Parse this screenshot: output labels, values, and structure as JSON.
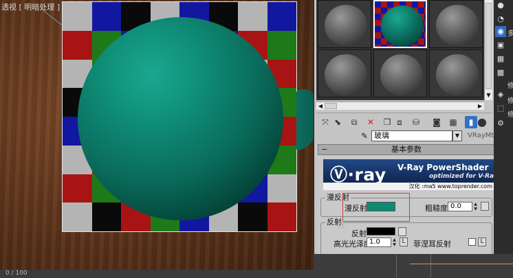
{
  "viewport": {
    "label": "透视 [ 明暗处理 ]",
    "frame_counter": "0 / 100"
  },
  "material_editor": {
    "slots": [
      {
        "name": "slot-1",
        "material": "gray"
      },
      {
        "name": "slot-2",
        "material": "teal",
        "active": true
      },
      {
        "name": "slot-3",
        "material": "gray"
      },
      {
        "name": "slot-4",
        "material": "gray"
      },
      {
        "name": "slot-5",
        "material": "gray"
      },
      {
        "name": "slot-6",
        "material": "gray"
      }
    ],
    "material_name": "玻璃",
    "material_type": "VRayMtl",
    "rollout_title": "基本参数",
    "vray_banner": {
      "logo": "v·ray",
      "title": "V-Ray PowerShader",
      "subtitle": "optimized for V-Ray",
      "credit": "汉化 :ma5 www.toprender.com"
    },
    "diffuse": {
      "group_title": "漫反射",
      "diffuse_label": "漫反射",
      "diffuse_color": "#0e8a73",
      "roughness_label": "粗糙度",
      "roughness_value": "0.0"
    },
    "reflection": {
      "group_title": "反射",
      "reflect_label": "反射",
      "reflect_color": "#000000",
      "hilight_gloss_label": "高光光泽度",
      "hilight_gloss_value": "1.0",
      "lock_label": "L",
      "fresnel_label": "菲涅耳反射",
      "lock_btn_label": "L"
    }
  },
  "command_panel": {
    "char_1": "多",
    "char_2": "修",
    "char_3": "修",
    "char_4": "修"
  }
}
